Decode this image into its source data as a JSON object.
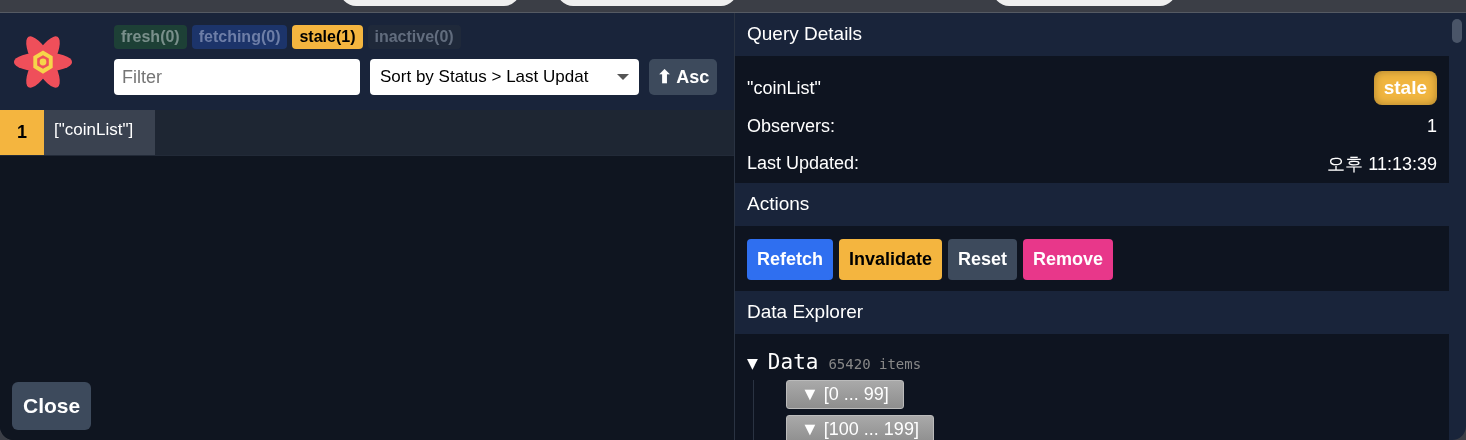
{
  "status_filters": [
    {
      "label": "fresh(0)",
      "kind": "fresh",
      "dimmed": true
    },
    {
      "label": "fetching(0)",
      "kind": "fetching",
      "dimmed": true
    },
    {
      "label": "stale(1)",
      "kind": "stale",
      "dimmed": false
    },
    {
      "label": "inactive(0)",
      "kind": "inactive",
      "dimmed": true
    }
  ],
  "filter": {
    "placeholder": "Filter"
  },
  "sort": {
    "value": "Sort by Status > Last Updat"
  },
  "order_button": {
    "arrow": "⬆",
    "label": "Asc"
  },
  "queries": [
    {
      "count": "1",
      "key": "[\"coinList\"]",
      "selected": true
    }
  ],
  "close_button": "Close",
  "details": {
    "title": "Query Details",
    "key": "\"coinList\"",
    "status": "stale",
    "observers_label": "Observers:",
    "observers": "1",
    "updated_label": "Last Updated:",
    "updated": "오후 11:13:39"
  },
  "actions": {
    "title": "Actions",
    "buttons": [
      {
        "label": "Refetch",
        "kind": "refetch"
      },
      {
        "label": "Invalidate",
        "kind": "invalidate"
      },
      {
        "label": "Reset",
        "kind": "reset"
      },
      {
        "label": "Remove",
        "kind": "remove"
      }
    ]
  },
  "explorer": {
    "title": "Data Explorer",
    "toggle": "▼",
    "label": "Data",
    "count": "65420 items",
    "ranges": [
      "▼ [0 ... 99]",
      "▼ [100 ... 199]"
    ]
  }
}
